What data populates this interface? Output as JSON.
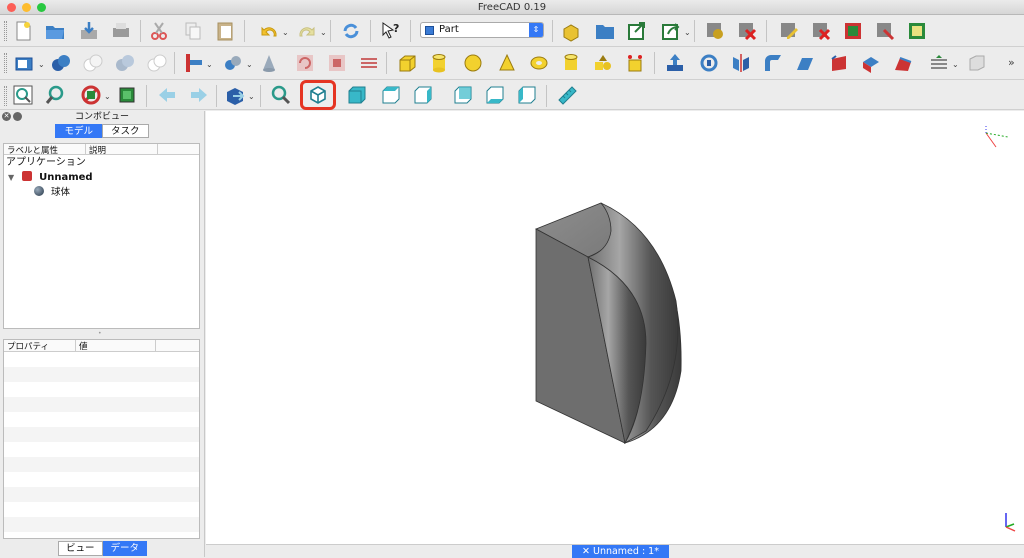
{
  "window": {
    "title": "FreeCAD 0.19"
  },
  "workbench": {
    "selected": "Part"
  },
  "combo": {
    "title": "コンボビュー",
    "tabs": [
      "モデル",
      "タスク"
    ],
    "tree_headers": [
      "ラベルと属性",
      "説明"
    ],
    "tree": {
      "root": "アプリケーション",
      "document": "Unnamed",
      "object": "球体"
    },
    "props_headers": [
      "プロパティ",
      "値"
    ],
    "bottom_tabs": [
      "ビュー",
      "データ"
    ]
  },
  "status": {
    "doc_tab": "Unnamed : 1*"
  },
  "colors": {
    "accent": "#3478f6",
    "highlight": "#e53422",
    "solid_top": "#8a8a8a",
    "solid_face": "#6f6f6f"
  },
  "icons": {
    "row1": [
      "new-document-icon",
      "open-icon",
      "save-icon",
      "print-icon",
      "cut-icon",
      "copy-icon",
      "paste-icon",
      "undo-icon",
      "redo-icon",
      "refresh-icon",
      "whats-this-icon",
      "box-workbench-icon",
      "folder-icon",
      "export-icon",
      "export-dropdown-icon",
      "macro-record-icon",
      "macro-stop-icon",
      "macro-edit-icon",
      "macro-execute-icon",
      "macro-debug-icon",
      "macro-step-icon"
    ],
    "row2": [
      "view-std-icon",
      "sync-view-icon",
      "link-icon",
      "link-group-icon",
      "unlink-icon",
      "part-tool-icon",
      "link-dropdown-icon",
      "cone-tool-icon",
      "undo-shape-icon",
      "shape-icon",
      "layers-icon",
      "box-icon",
      "cylinder-icon",
      "sphere-icon",
      "cone-icon",
      "torus-icon",
      "tube-icon",
      "primitives-icon",
      "shape-builder-icon",
      "extrude-icon",
      "revolve-icon",
      "mirror-icon",
      "fillet-icon",
      "chamfer-icon",
      "face-icon",
      "ruled-surface-icon",
      "loft-icon",
      "sweep-icon",
      "section-icon",
      "cross-section-icon",
      "offset-icon"
    ],
    "row3": [
      "fit-all-icon",
      "fit-selection-icon",
      "draw-style-icon",
      "bounding-box-icon",
      "back-icon",
      "forward-icon",
      "view-sync-icon",
      "zoom-icon",
      "isometric-view-icon",
      "front-view-icon",
      "top-view-icon",
      "right-view-icon",
      "rear-view-icon",
      "bottom-view-icon",
      "left-view-icon",
      "measure-icon"
    ]
  }
}
